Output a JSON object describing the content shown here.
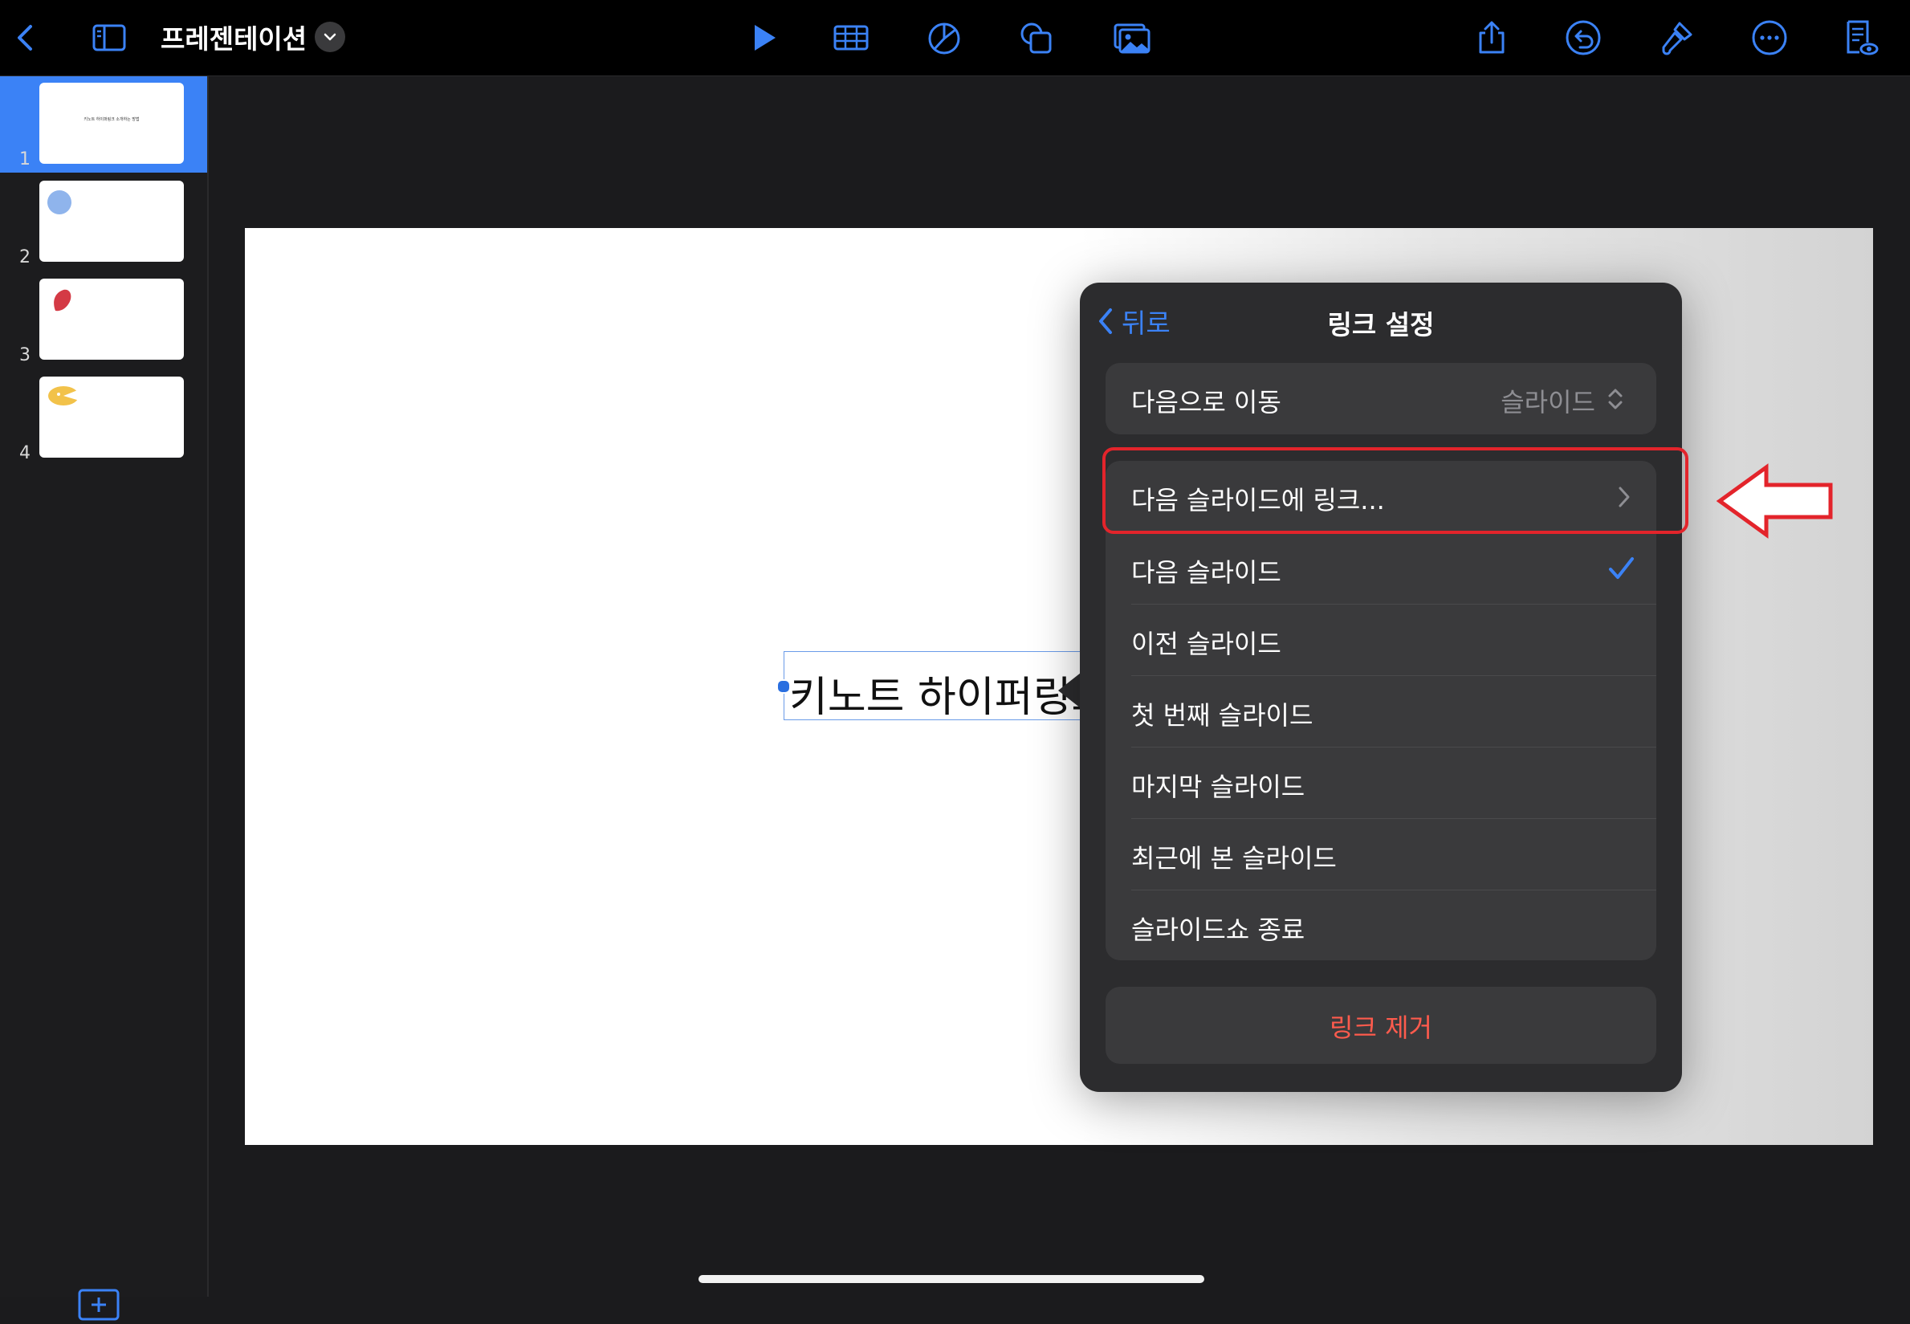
{
  "toolbar": {
    "document_title": "프레젠테이션",
    "accent_color": "#3b82f6",
    "icons": [
      "back-chevron-icon",
      "sidebar-toggle-icon",
      "title-menu-chevron-icon",
      "play-icon",
      "table-icon",
      "chart-icon",
      "shapes-icon",
      "media-icon",
      "share-icon",
      "undo-icon",
      "format-brush-icon",
      "more-icon",
      "presenter-notes-icon"
    ]
  },
  "sidebar": {
    "slides": [
      {
        "number": "1",
        "selected": true,
        "preview_text": "키노트 하이퍼링크 소개하는 방법"
      },
      {
        "number": "2",
        "selected": false,
        "shape": "blue-circle"
      },
      {
        "number": "3",
        "selected": false,
        "shape": "red-leaf"
      },
      {
        "number": "4",
        "selected": false,
        "shape": "yellow-pacman"
      }
    ],
    "add_slide_icon": "add-slide-icon"
  },
  "slide": {
    "text": "키노트 하이퍼링크"
  },
  "popover": {
    "back_label": "뒤로",
    "title": "링크 설정",
    "navigate_label": "다음으로 이동",
    "navigate_value": "슬라이드",
    "link_to_slide_label": "다음 슬라이드에 링크...",
    "options": [
      {
        "label": "다음 슬라이드",
        "checked": true
      },
      {
        "label": "이전 슬라이드",
        "checked": false
      },
      {
        "label": "첫 번째 슬라이드",
        "checked": false
      },
      {
        "label": "마지막 슬라이드",
        "checked": false
      },
      {
        "label": "최근에 본 슬라이드",
        "checked": false
      },
      {
        "label": "슬라이드쇼 종료",
        "checked": false
      }
    ],
    "remove_link_label": "링크 제거",
    "destructive_color": "#ff5b4d"
  },
  "annotation": {
    "highlight_color": "#e3242b"
  }
}
